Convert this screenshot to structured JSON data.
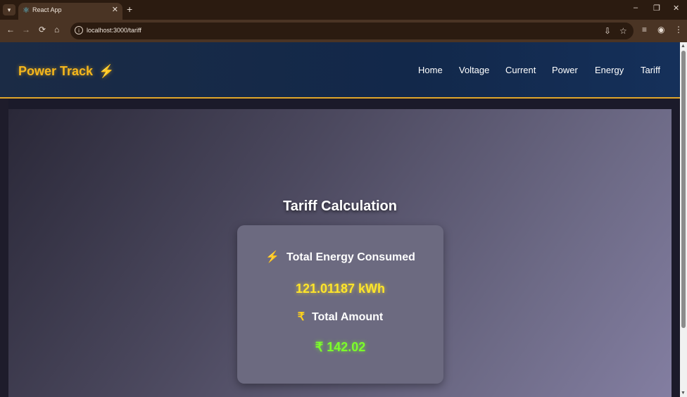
{
  "browser": {
    "tab_title": "React App",
    "tab_favicon": "react-icon",
    "tab_close": "✕",
    "new_tab": "+",
    "url": "localhost:3000/tariff",
    "window_controls": {
      "minimize": "–",
      "restore": "❐",
      "close": "✕"
    },
    "nav_buttons": {
      "back": "←",
      "forward": "→",
      "reload": "⟳",
      "home": "⌂"
    },
    "toolbar_icons": [
      "install-icon",
      "star-icon",
      "media-icon",
      "profile-icon",
      "menu-icon"
    ]
  },
  "header": {
    "brand": "Power Track",
    "brand_icon": "⚡",
    "nav": [
      "Home",
      "Voltage",
      "Current",
      "Power",
      "Energy",
      "Tariff"
    ]
  },
  "main": {
    "title": "Tariff Calculation",
    "energy_label": "Total Energy Consumed",
    "energy_icon": "⚡",
    "energy_value": "121.01187 kWh",
    "amount_label": "Total Amount",
    "amount_icon": "₹",
    "amount_value": "₹ 142.02"
  },
  "colors": {
    "brand": "#f6b71c",
    "accent_border": "#e0a52a",
    "energy_value": "#ffe52a",
    "amount_value": "#7cff2a"
  }
}
